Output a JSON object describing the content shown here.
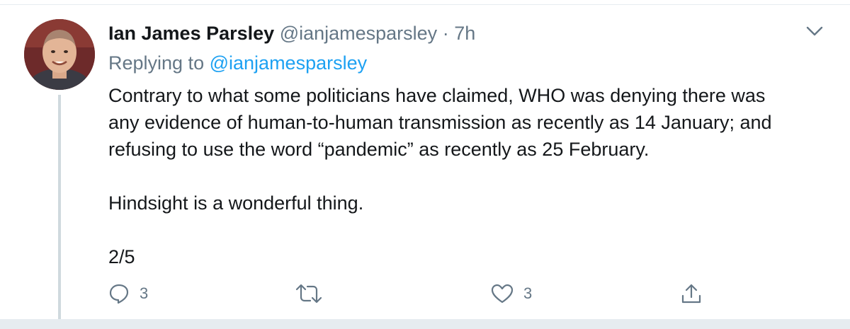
{
  "tweet": {
    "author_name": "Ian James Parsley",
    "author_handle": "@ianjamesparsley",
    "separator": "·",
    "timestamp": "7h",
    "replying_prefix": "Replying to",
    "replying_handle": "@ianjamesparsley",
    "body_lines": [
      "Contrary to what some politicians have claimed, WHO was denying there was",
      "any evidence of human-to-human transmission as recently as 14 January; and",
      "refusing to use the word “pandemic” as recently as 25 February.",
      "Hindsight is a wonderful thing.",
      "2/5"
    ]
  },
  "actions": {
    "reply_count": "3",
    "like_count": "3",
    "reply_icon": "reply-icon",
    "retweet_icon": "retweet-icon",
    "like_icon": "heart-icon",
    "share_icon": "share-icon"
  },
  "colors": {
    "text": "#14171a",
    "muted": "#657786",
    "link": "#1da1f2",
    "divider": "#e6ecf0"
  }
}
